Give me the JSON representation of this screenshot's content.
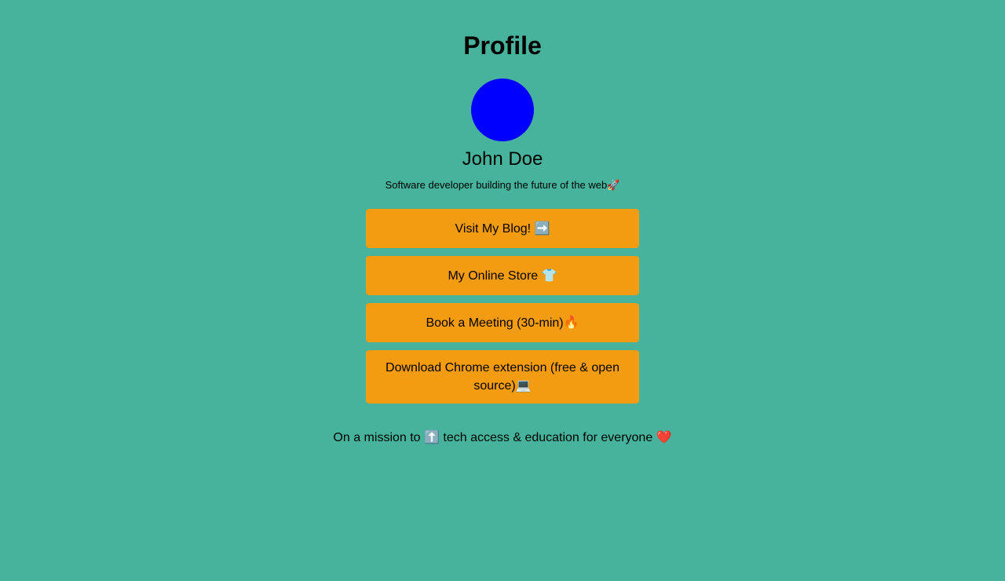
{
  "profile": {
    "title": "Profile",
    "avatar_color": "#0000ff",
    "name": "John Doe",
    "bio": "Software developer building the future of the web🚀"
  },
  "links": [
    {
      "label": "Visit My Blog! ➡️"
    },
    {
      "label": "My Online Store 👕"
    },
    {
      "label": "Book a Meeting (30-min)🔥"
    },
    {
      "label": "Download Chrome extension (free & open source)💻"
    }
  ],
  "footer": {
    "mission": "On a mission to ⬆️ tech access & education for everyone ❤️"
  },
  "colors": {
    "background": "#48b39c",
    "button": "#f39c12"
  }
}
